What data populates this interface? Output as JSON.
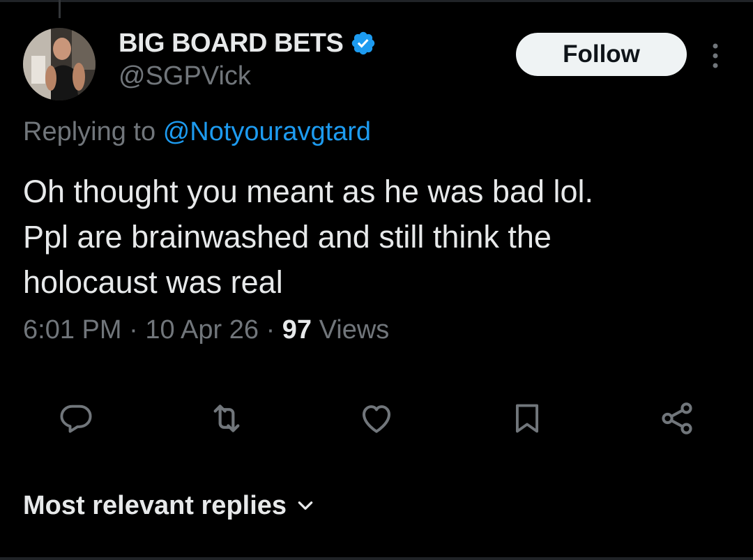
{
  "tweet": {
    "author": {
      "display_name": "BIG BOARD BETS",
      "handle": "@SGPVick",
      "verified": true
    },
    "follow_label": "Follow",
    "replying_to": {
      "prefix": "Replying to",
      "mention": "@Notyouravgtard"
    },
    "text_lines": [
      "Oh thought you meant as he was bad lol.",
      "Ppl are brainwashed and still think the",
      "holocaust was real"
    ],
    "meta": {
      "time": "6:01 PM",
      "date": "10 Apr 26",
      "views_count": "97",
      "views_label": "Views",
      "separator": "·"
    }
  },
  "actions": {
    "icons": [
      "reply-icon",
      "retweet-icon",
      "like-icon",
      "bookmark-icon",
      "share-icon"
    ]
  },
  "replies_sort": {
    "label": "Most relevant replies"
  },
  "colors": {
    "background": "#000000",
    "text_primary": "#e7e9ea",
    "text_secondary": "#71767b",
    "accent": "#1d9bf0",
    "button_bg": "#eff3f4"
  }
}
